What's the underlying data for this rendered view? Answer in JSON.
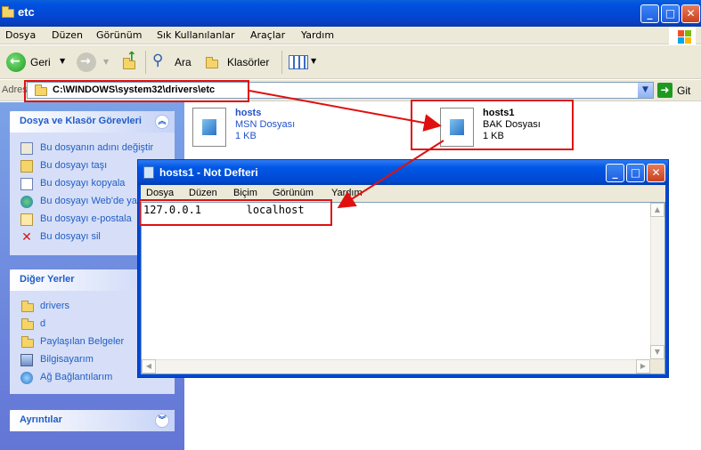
{
  "explorer": {
    "title": "etc",
    "menu": [
      "Dosya",
      "Düzen",
      "Görünüm",
      "Sık Kullanılanlar",
      "Araçlar",
      "Yardım"
    ],
    "toolbar": {
      "back": "Geri",
      "search": "Ara",
      "folders": "Klasörler"
    },
    "address": {
      "label": "Adres",
      "path": "C:\\WINDOWS\\system32\\drivers\\etc",
      "go": "Git"
    }
  },
  "taskpane": {
    "tasks": {
      "title": "Dosya ve Klasör Görevleri",
      "items": [
        "Bu dosyanın adını değiştir",
        "Bu dosyayı taşı",
        "Bu dosyayı kopyala",
        "Bu dosyayı Web'de yayımla",
        "Bu dosyayı e-postala",
        "Bu dosyayı sil"
      ]
    },
    "places": {
      "title": "Diğer Yerler",
      "items": [
        "drivers",
        "d",
        "Paylaşılan Belgeler",
        "Bilgisayarım",
        "Ağ Bağlantılarım"
      ]
    },
    "details": {
      "title": "Ayrıntılar"
    }
  },
  "files": [
    {
      "name": "hosts",
      "type": "MSN Dosyası",
      "size": "1 KB"
    },
    {
      "name": "hosts1",
      "type": "BAK Dosyası",
      "size": "1 KB"
    }
  ],
  "notepad": {
    "title": "hosts1 - Not Defteri",
    "menu": [
      "Dosya",
      "Düzen",
      "Biçim",
      "Görünüm",
      "Yardım"
    ],
    "content": "127.0.0.1       localhost"
  },
  "colors": {
    "annotation": "#e01010",
    "titlebar": "#0050e0",
    "taskpane_link": "#215dc6"
  }
}
